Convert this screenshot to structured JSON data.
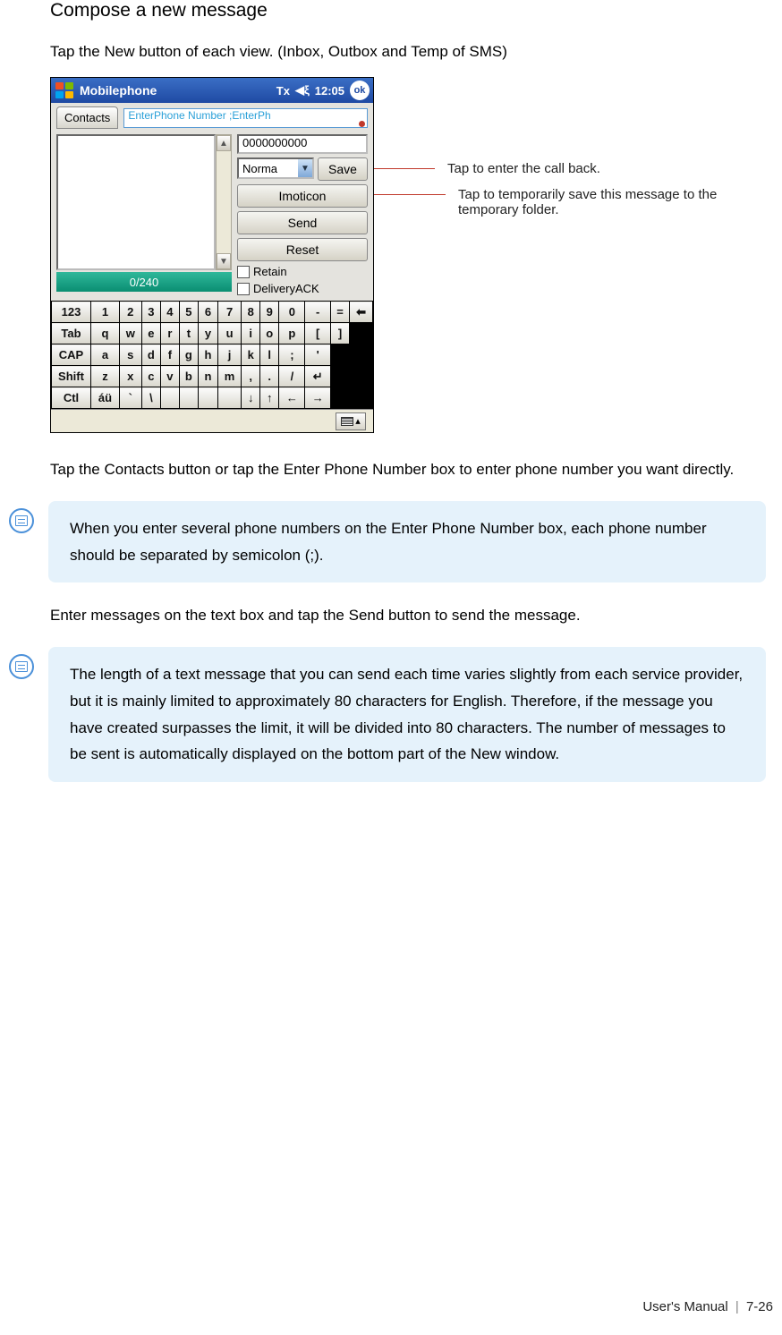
{
  "heading": "Compose a new message",
  "subtext": "Tap the New button of each view. (Inbox, Outbox and Temp of SMS)",
  "phone": {
    "title": "Mobilephone",
    "signal_icon": "Tx",
    "sound_icon": "◀ξ",
    "time": "12:05",
    "ok": "ok",
    "contacts_tab": "Contacts",
    "phone_number_placeholder": "EnterPhone Number ;EnterPh",
    "callback_value": "0000000000",
    "priority": "Norma",
    "save_btn": "Save",
    "imoticon_btn": "Imoticon",
    "send_btn": "Send",
    "reset_btn": "Reset",
    "retain_label": "Retain",
    "delivery_label": "DeliveryACK",
    "counter": "0/240",
    "sip_label": ""
  },
  "keyboard": {
    "r1": [
      "123",
      "1",
      "2",
      "3",
      "4",
      "5",
      "6",
      "7",
      "8",
      "9",
      "0",
      "-",
      "=",
      "⬅"
    ],
    "r2": [
      "Tab",
      "q",
      "w",
      "e",
      "r",
      "t",
      "y",
      "u",
      "i",
      "o",
      "p",
      "[",
      "]"
    ],
    "r3": [
      "CAP",
      "a",
      "s",
      "d",
      "f",
      "g",
      "h",
      "j",
      "k",
      "l",
      ";",
      "'"
    ],
    "r4": [
      "Shift",
      "z",
      "x",
      "c",
      "v",
      "b",
      "n",
      "m",
      ",",
      ".",
      "/",
      "↵"
    ],
    "r5": [
      "Ctl",
      "áü",
      "`",
      "\\",
      "",
      "",
      "",
      "",
      "↓",
      "↑",
      "←",
      "→"
    ]
  },
  "callouts": {
    "c1": "Tap to enter the call back.",
    "c2": "Tap to temporarily save this message to the temporary folder."
  },
  "para1": "Tap the Contacts button or tap the Enter Phone Number box to enter phone number you want directly.",
  "note1": "When you enter several phone numbers on the Enter Phone Number box, each phone number should be separated by semicolon (;).",
  "para2": "Enter messages on the text box and tap the Send button to send the message.",
  "note2": "The length of a text message that you can send each time varies slightly from each service provider, but it is mainly limited to approximately 80 characters for English. Therefore, if the message you have created surpasses the limit, it will be divided into 80 characters. The number of messages to be sent is automatically displayed on the bottom part of the New window.",
  "footer": {
    "manual": "User's Manual",
    "page": "7-26"
  }
}
